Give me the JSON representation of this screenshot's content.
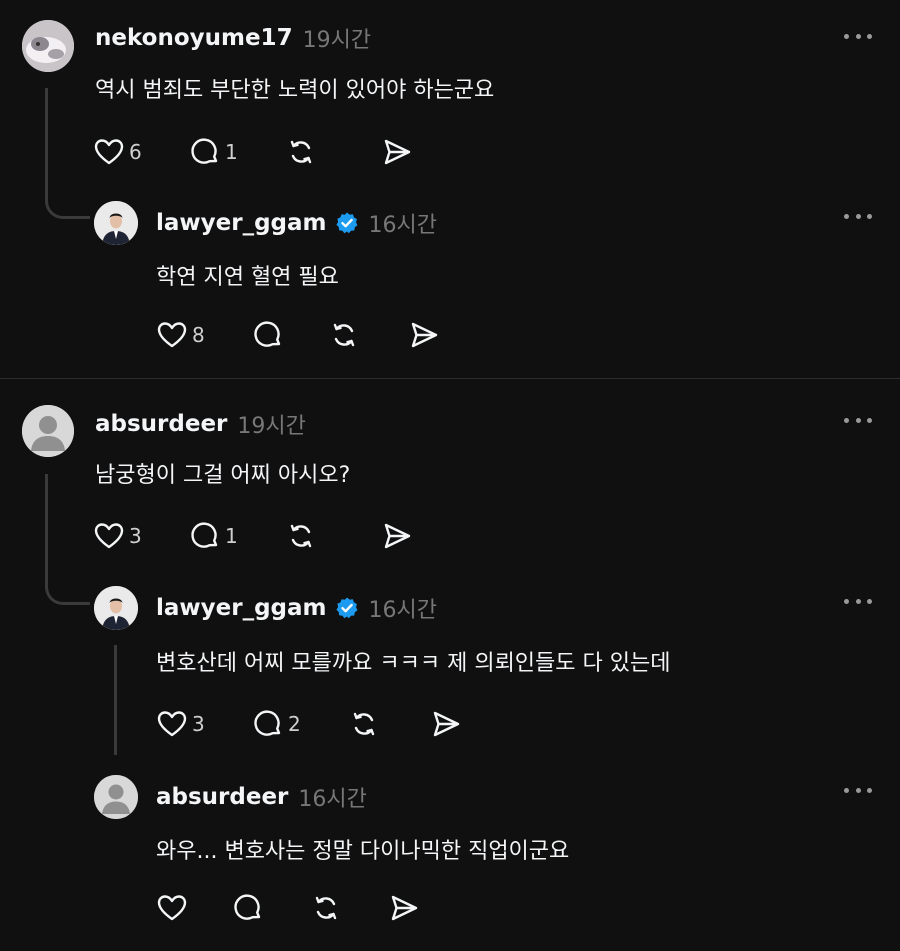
{
  "threads": [
    {
      "post": {
        "username": "nekonoyume17",
        "time": "19시간",
        "text": "역시 범죄도 부단한 노력이 있어야 하는군요",
        "likes": "6",
        "replies": "1"
      },
      "reply": {
        "username": "lawyer_ggam",
        "time": "16시간",
        "text": "학연 지연 혈연 필요",
        "likes": "8"
      }
    },
    {
      "post": {
        "username": "absurdeer",
        "time": "19시간",
        "text": "남궁형이 그걸 어찌 아시오?",
        "likes": "3",
        "replies": "1"
      },
      "reply": {
        "username": "lawyer_ggam",
        "time": "16시간",
        "text": "변호산데 어찌 모를까요 ㅋㅋㅋ 제 의뢰인들도 다 있는데",
        "likes": "3",
        "replies": "2"
      },
      "reply2": {
        "username": "absurdeer",
        "time": "16시간",
        "text": "와우... 변호사는 정말 다이나믹한 직업이군요"
      }
    }
  ],
  "colors": {
    "background": "#101010",
    "verified": "#1d9bf0",
    "muted": "#777777"
  }
}
